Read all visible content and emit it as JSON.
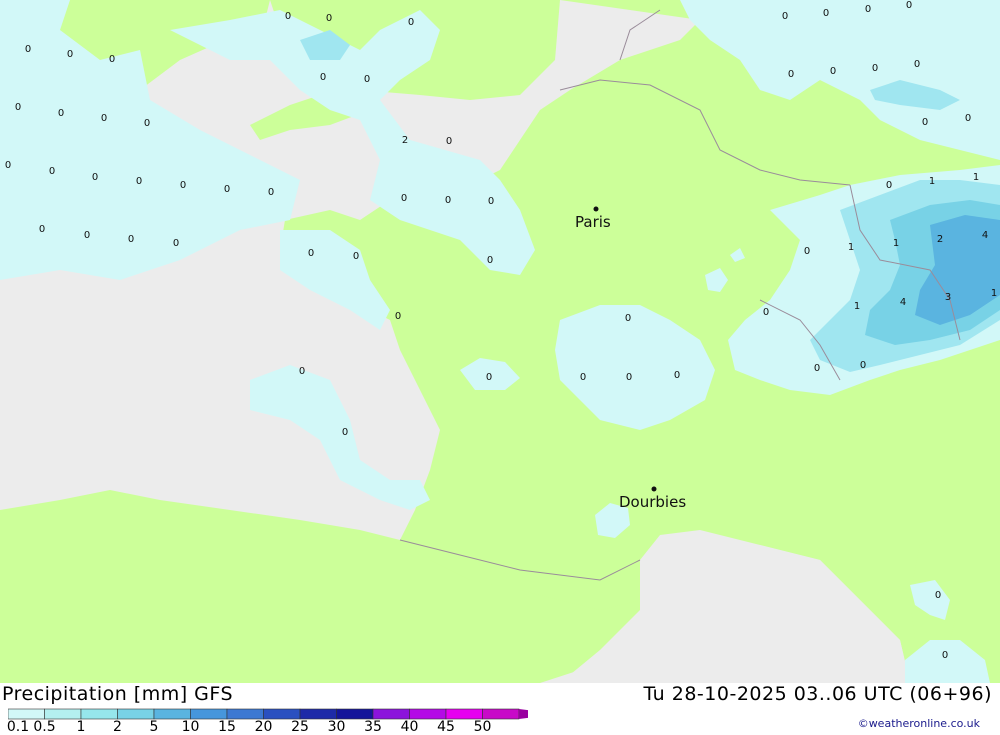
{
  "map": {
    "cities": [
      {
        "name": "Paris"
      },
      {
        "name": "Dourbies"
      }
    ],
    "values": [
      "0",
      "1",
      "2",
      "3",
      "4"
    ]
  },
  "footer": {
    "title": "Precipitation [mm] GFS",
    "datetime": "Tu 28-10-2025 03..06 UTC (06+96)",
    "credit": "©weatheronline.co.uk"
  },
  "legend": {
    "labels": [
      "0.1",
      "0.5",
      "1",
      "2",
      "5",
      "10",
      "15",
      "20",
      "25",
      "30",
      "35",
      "40",
      "45",
      "50"
    ],
    "colors": [
      "#d2f8f8",
      "#b4f0f0",
      "#96e6ec",
      "#78d2e6",
      "#5ab4e0",
      "#4696dc",
      "#3c78d2",
      "#2a50c0",
      "#1e2aa8",
      "#14149a",
      "#8c14dc",
      "#b40ae6",
      "#e600f0",
      "#c80ac8",
      "#9a00a0"
    ]
  },
  "colors": {
    "sea": "#ececec",
    "land": "#ccff99",
    "precip_light": "#d2f8f8",
    "precip_mid": "#a0e6f0",
    "precip_heavy": "#5ac8e6",
    "precip_max": "#46aadc"
  }
}
